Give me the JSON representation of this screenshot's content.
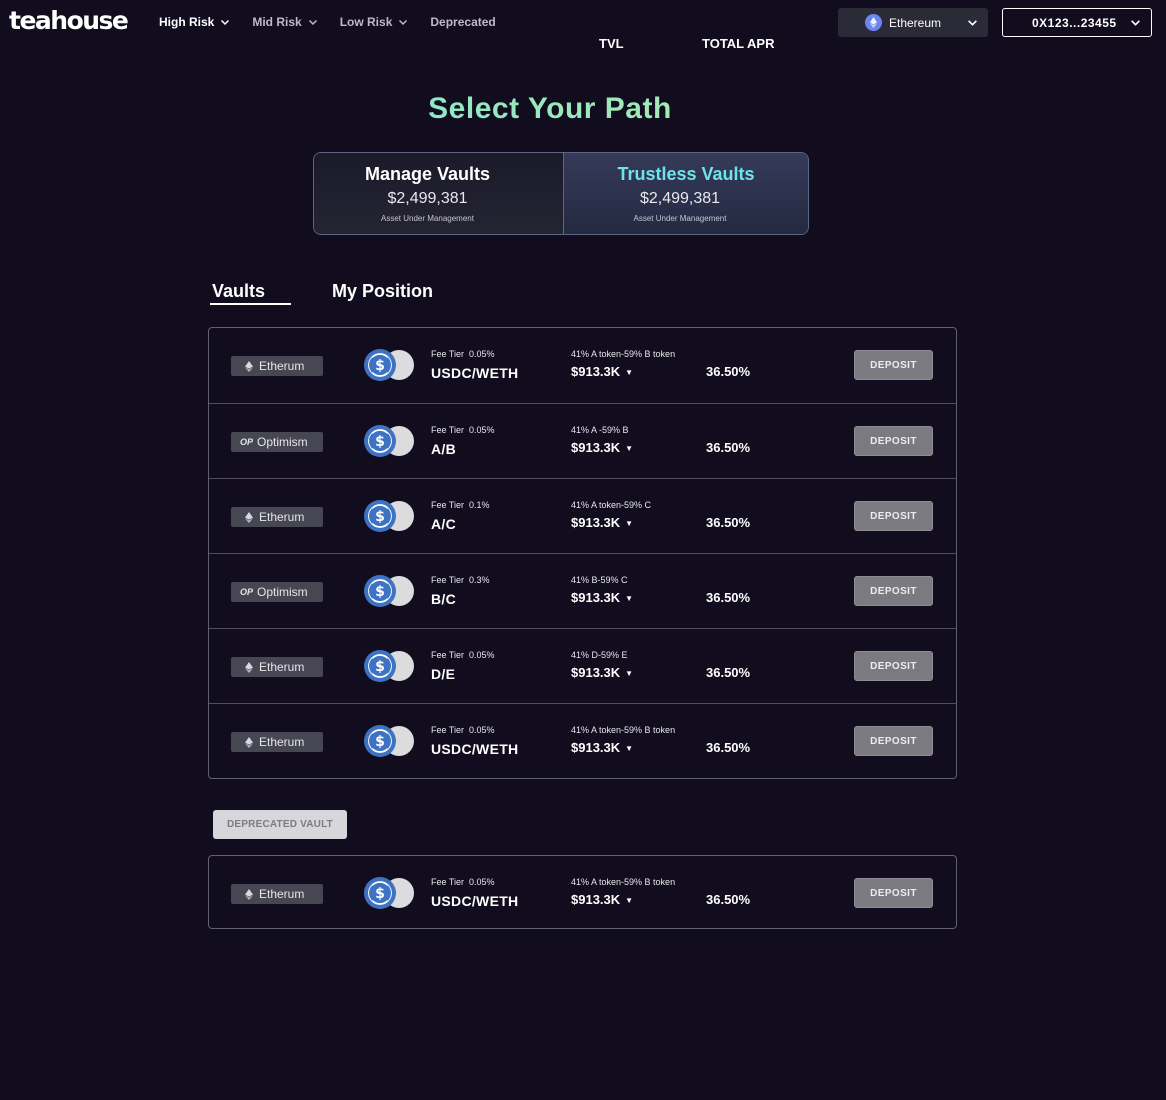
{
  "header": {
    "logo": "teahouse",
    "nav": [
      {
        "label": "High Risk",
        "has_dropdown": true
      },
      {
        "label": "Mid Risk",
        "has_dropdown": true
      },
      {
        "label": "Low Risk",
        "has_dropdown": true
      },
      {
        "label": "Deprecated",
        "has_dropdown": false
      }
    ],
    "network": {
      "label": "Ethereum",
      "icon": "ethereum-icon"
    },
    "wallet": {
      "label": "0X123...23455"
    }
  },
  "hero": {
    "title": "Select Your Path",
    "cards": [
      {
        "title": "Manage Vaults",
        "amount": "$2,499,381",
        "subtitle": "Asset Under Management"
      },
      {
        "title": "Trustless Vaults",
        "amount": "$2,499,381",
        "subtitle": "Asset Under Management"
      }
    ]
  },
  "tabs": {
    "vaults": "Vaults",
    "position": "My Position"
  },
  "columns": {
    "tvl": "TVL",
    "apr": "TOTAL APR"
  },
  "vaults": [
    {
      "chain": "Etherum",
      "chain_icon": "ethereum-icon",
      "fee_label": "Fee Tier",
      "fee": "0.05%",
      "pair": "USDC/WETH",
      "ratio": "41% A token-59% B token",
      "tvl": "$913.3K",
      "apr": "36.50%",
      "button": "DEPOSIT"
    },
    {
      "chain": "Optimism",
      "chain_icon": "optimism-icon",
      "fee_label": "Fee Tier",
      "fee": "0.05%",
      "pair": "A/B",
      "ratio": "41% A -59% B",
      "tvl": "$913.3K",
      "apr": "36.50%",
      "button": "DEPOSIT"
    },
    {
      "chain": "Etherum",
      "chain_icon": "ethereum-icon",
      "fee_label": "Fee Tier",
      "fee": "0.1%",
      "pair": "A/C",
      "ratio": "41% A token-59% C",
      "tvl": "$913.3K",
      "apr": "36.50%",
      "button": "DEPOSIT"
    },
    {
      "chain": "Optimism",
      "chain_icon": "optimism-icon",
      "fee_label": "Fee Tier",
      "fee": "0.3%",
      "pair": "B/C",
      "ratio": "41% B-59% C",
      "tvl": "$913.3K",
      "apr": "36.50%",
      "button": "DEPOSIT"
    },
    {
      "chain": "Etherum",
      "chain_icon": "ethereum-icon",
      "fee_label": "Fee Tier",
      "fee": "0.05%",
      "pair": "D/E",
      "ratio": "41% D-59% E",
      "tvl": "$913.3K",
      "apr": "36.50%",
      "button": "DEPOSIT"
    },
    {
      "chain": "Etherum",
      "chain_icon": "ethereum-icon",
      "fee_label": "Fee Tier",
      "fee": "0.05%",
      "pair": "USDC/WETH",
      "ratio": "41% A token-59% B token",
      "tvl": "$913.3K",
      "apr": "36.50%",
      "button": "DEPOSIT"
    }
  ],
  "deprecated": {
    "button": "DEPRECATED VAULT",
    "vaults": [
      {
        "chain": "Etherum",
        "chain_icon": "ethereum-icon",
        "fee_label": "Fee Tier",
        "fee": "0.05%",
        "pair": "USDC/WETH",
        "ratio": "41% A token-59% B token",
        "tvl": "$913.3K",
        "apr": "36.50%",
        "button": "DEPOSIT"
      }
    ]
  },
  "colors": {
    "background": "#110c1e",
    "accent_cyan": "#6fe3ea",
    "title_gradient_end": "#d6f2a0",
    "usdc_blue": "#3e73c4",
    "eth_blue": "#6b86f0"
  }
}
